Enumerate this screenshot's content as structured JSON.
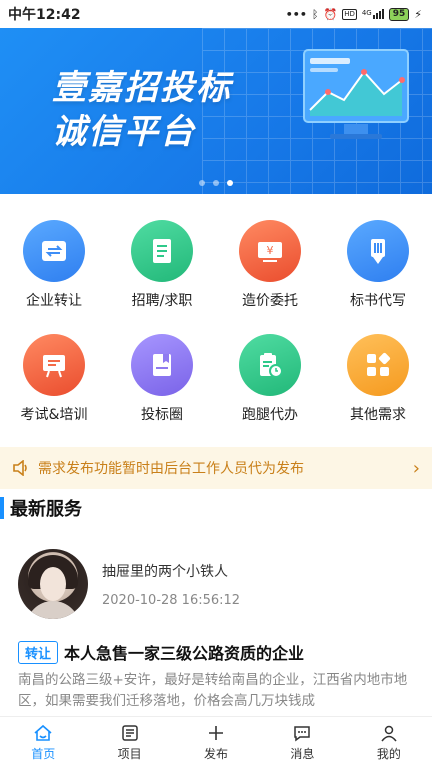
{
  "status_bar": {
    "time": "中午12:42",
    "dots": "•••",
    "network": "4G",
    "hd": "HD",
    "battery": "95"
  },
  "banner": {
    "title_line1": "壹嘉招投标",
    "title_line2": "诚信平台"
  },
  "services": [
    {
      "label": "企业转让",
      "icon": "transfer-icon",
      "color": "#3d8ef7"
    },
    {
      "label": "招聘/求职",
      "icon": "document-icon",
      "color": "#2ec98a"
    },
    {
      "label": "造价委托",
      "icon": "money-icon",
      "color": "#f46b49"
    },
    {
      "label": "标书代写",
      "icon": "pen-icon",
      "color": "#3d8ef7"
    },
    {
      "label": "考试&培训",
      "icon": "board-icon",
      "color": "#f46b49"
    },
    {
      "label": "投标圈",
      "icon": "bookmark-icon",
      "color": "#8f7bf0"
    },
    {
      "label": "跑腿代办",
      "icon": "clipboard-clock-icon",
      "color": "#2ec98a"
    },
    {
      "label": "其他需求",
      "icon": "grid-icon",
      "color": "#f7a531"
    }
  ],
  "notice": {
    "text": "需求发布功能暂时由后台工作人员代为发布"
  },
  "section": {
    "title": "最新服务"
  },
  "post": {
    "user_name": "抽屉里的两个小铁人",
    "time": "2020-10-28 16:56:12",
    "tag": "转让",
    "title": "本人急售一家三级公路资质的企业",
    "body": "南昌的公路三级+安许，最好是转给南昌的企业，江西省内地市地区，如果需要我们迁移落地，价格会高几万块钱成"
  },
  "tabs": [
    {
      "label": "首页",
      "icon": "home-icon",
      "active": true
    },
    {
      "label": "项目",
      "icon": "list-icon"
    },
    {
      "label": "发布",
      "icon": "plus-icon"
    },
    {
      "label": "消息",
      "icon": "chat-icon"
    },
    {
      "label": "我的",
      "icon": "user-icon"
    }
  ],
  "colors": {
    "accent": "#1890ff",
    "banner": "#1779e8",
    "notice_bg": "#fdf6e5",
    "notice_text": "#c9801a"
  }
}
